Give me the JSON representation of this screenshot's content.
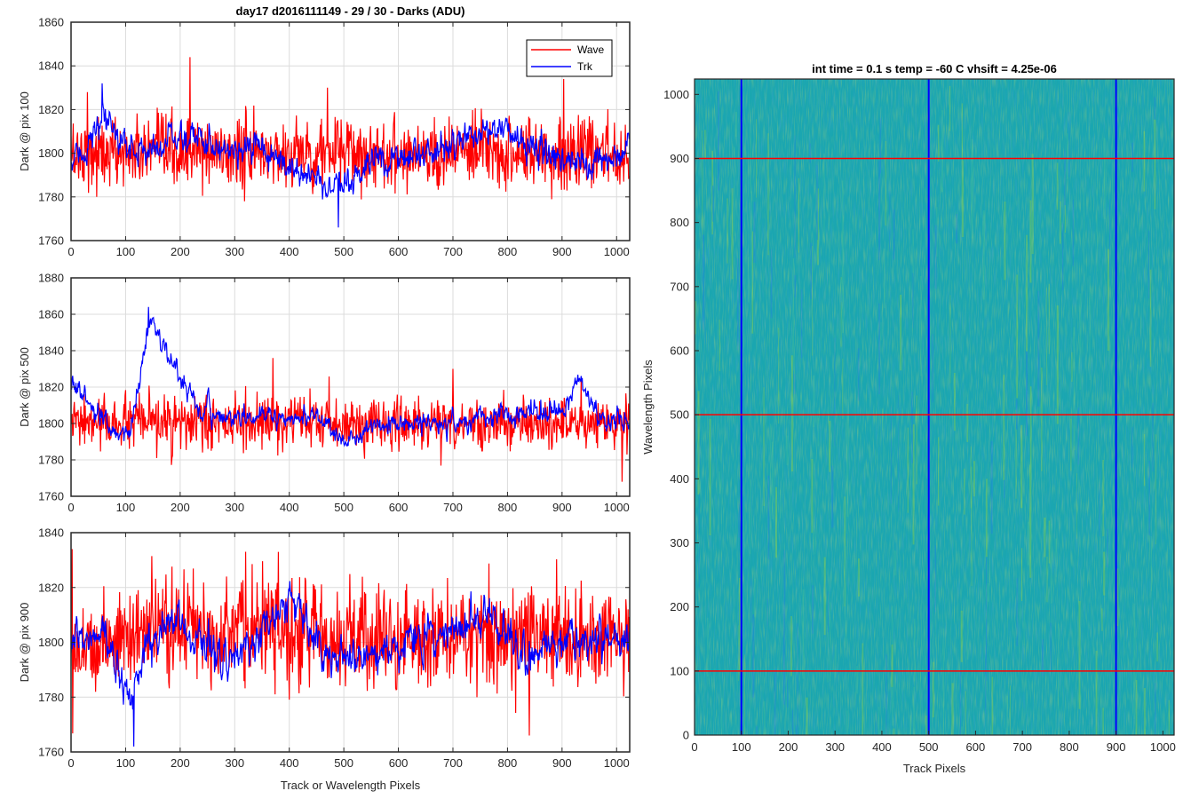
{
  "figure_title": "day17 d2016111149 - 29 / 30 - Darks (ADU)",
  "colors": {
    "wave": "#ff0000",
    "trk": "#0000ff",
    "grid": "#dcdcdc",
    "axis": "#262626",
    "legend_border": "#000000"
  },
  "legend": {
    "entries": [
      {
        "name": "Wave",
        "color": "#ff0000"
      },
      {
        "name": "Trk",
        "color": "#0000ff"
      }
    ],
    "placement": "top-right"
  },
  "chart_data": [
    {
      "type": "line",
      "panel": "top-left",
      "title": "day17 d2016111149 - 29 / 30 - Darks (ADU)",
      "xlabel": "",
      "ylabel": "Dark @ pix 100",
      "xlim": [
        0,
        1024
      ],
      "ylim": [
        1760,
        1860
      ],
      "xticks": [
        0,
        100,
        200,
        300,
        400,
        500,
        600,
        700,
        800,
        900,
        1000
      ],
      "yticks": [
        1760,
        1780,
        1800,
        1820,
        1840,
        1860
      ],
      "grid": true,
      "legend": "top-right",
      "series": [
        {
          "name": "Wave",
          "color": "#ff0000",
          "n_points": 1024,
          "mean": 1800,
          "noise_std": 8,
          "spikes": [
            [
              218,
              1844
            ],
            [
              903,
              1834
            ],
            [
              470,
              1830
            ],
            [
              30,
              1828
            ]
          ],
          "drift": [
            [
              0,
              0
            ],
            [
              1024,
              0
            ]
          ]
        },
        {
          "name": "Trk",
          "color": "#0000ff",
          "n_points": 1024,
          "mean": 1800,
          "noise_std": 5,
          "spikes": [
            [
              57,
              1832
            ],
            [
              490,
              1766
            ]
          ],
          "drift": [
            [
              0,
              -6
            ],
            [
              60,
              14
            ],
            [
              120,
              0
            ],
            [
              200,
              8
            ],
            [
              350,
              0
            ],
            [
              420,
              -8
            ],
            [
              500,
              -18
            ],
            [
              560,
              -2
            ],
            [
              650,
              0
            ],
            [
              780,
              12
            ],
            [
              860,
              2
            ],
            [
              950,
              -8
            ],
            [
              1024,
              4
            ]
          ]
        }
      ]
    },
    {
      "type": "line",
      "panel": "middle-left",
      "title": "",
      "xlabel": "",
      "ylabel": "Dark @ pix 500",
      "xlim": [
        0,
        1024
      ],
      "ylim": [
        1760,
        1880
      ],
      "xticks": [
        0,
        100,
        200,
        300,
        400,
        500,
        600,
        700,
        800,
        900,
        1000
      ],
      "yticks": [
        1760,
        1780,
        1800,
        1820,
        1840,
        1860,
        1880
      ],
      "grid": true,
      "series": [
        {
          "name": "Wave",
          "color": "#ff0000",
          "n_points": 1024,
          "mean": 1800,
          "noise_std": 7,
          "spikes": [
            [
              370,
              1836
            ],
            [
              700,
              1830
            ],
            [
              1010,
              1768
            ]
          ],
          "drift": [
            [
              0,
              0
            ],
            [
              1024,
              0
            ]
          ]
        },
        {
          "name": "Trk",
          "color": "#0000ff",
          "n_points": 1024,
          "mean": 1800,
          "noise_std": 4,
          "spikes": [
            [
              142,
              1864
            ]
          ],
          "drift": [
            [
              0,
              24
            ],
            [
              40,
              8
            ],
            [
              80,
              -8
            ],
            [
              110,
              -2
            ],
            [
              145,
              58
            ],
            [
              190,
              30
            ],
            [
              240,
              6
            ],
            [
              300,
              3
            ],
            [
              470,
              4
            ],
            [
              500,
              -14
            ],
            [
              560,
              0
            ],
            [
              700,
              0
            ],
            [
              900,
              8
            ],
            [
              930,
              24
            ],
            [
              970,
              4
            ],
            [
              1024,
              -2
            ]
          ]
        }
      ]
    },
    {
      "type": "line",
      "panel": "bottom-left",
      "title": "",
      "xlabel": "Track or Wavelength Pixels",
      "ylabel": "Dark @ pix 900",
      "xlim": [
        0,
        1024
      ],
      "ylim": [
        1760,
        1840
      ],
      "xticks": [
        0,
        100,
        200,
        300,
        400,
        500,
        600,
        700,
        800,
        900,
        1000
      ],
      "yticks": [
        1760,
        1780,
        1800,
        1820,
        1840
      ],
      "grid": true,
      "series": [
        {
          "name": "Wave",
          "color": "#ff0000",
          "n_points": 1024,
          "mean": 1800,
          "noise_std": 9,
          "spikes": [
            [
              2,
              1834
            ],
            [
              380,
              1833
            ],
            [
              840,
              1766
            ]
          ],
          "drift": [
            [
              0,
              -2
            ],
            [
              200,
              6
            ],
            [
              400,
              4
            ],
            [
              600,
              0
            ],
            [
              800,
              4
            ],
            [
              1024,
              0
            ]
          ]
        },
        {
          "name": "Trk",
          "color": "#0000ff",
          "n_points": 1024,
          "mean": 1800,
          "noise_std": 5,
          "spikes": [
            [
              115,
              1762
            ]
          ],
          "drift": [
            [
              0,
              -2
            ],
            [
              60,
              4
            ],
            [
              110,
              -22
            ],
            [
              140,
              0
            ],
            [
              190,
              8
            ],
            [
              300,
              -8
            ],
            [
              400,
              18
            ],
            [
              460,
              -6
            ],
            [
              560,
              -4
            ],
            [
              770,
              10
            ],
            [
              830,
              -4
            ],
            [
              900,
              0
            ],
            [
              1024,
              0
            ]
          ]
        }
      ]
    },
    {
      "type": "heatmap",
      "panel": "right",
      "title": "int time = 0.1 s   temp = -60 C   vhsift = 4.25e-06",
      "xlabel": "Track Pixels",
      "ylabel": "Wavelength Pixels",
      "xlim": [
        0,
        1024
      ],
      "ylim": [
        0,
        1024
      ],
      "xticks": [
        0,
        100,
        200,
        300,
        400,
        500,
        600,
        700,
        800,
        900,
        1000
      ],
      "yticks": [
        0,
        100,
        200,
        300,
        400,
        500,
        600,
        700,
        800,
        900,
        1000
      ],
      "colormap": "parula",
      "base_color": "#1aa6b0",
      "overlay_lines": [
        {
          "orientation": "vertical",
          "value": 100,
          "color": "#0000ff"
        },
        {
          "orientation": "vertical",
          "value": 500,
          "color": "#0000ff"
        },
        {
          "orientation": "vertical",
          "value": 900,
          "color": "#0000ff"
        },
        {
          "orientation": "horizontal",
          "value": 100,
          "color": "#ff0000"
        },
        {
          "orientation": "horizontal",
          "value": 500,
          "color": "#ff0000"
        },
        {
          "orientation": "horizontal",
          "value": 900,
          "color": "#ff0000"
        }
      ]
    }
  ]
}
